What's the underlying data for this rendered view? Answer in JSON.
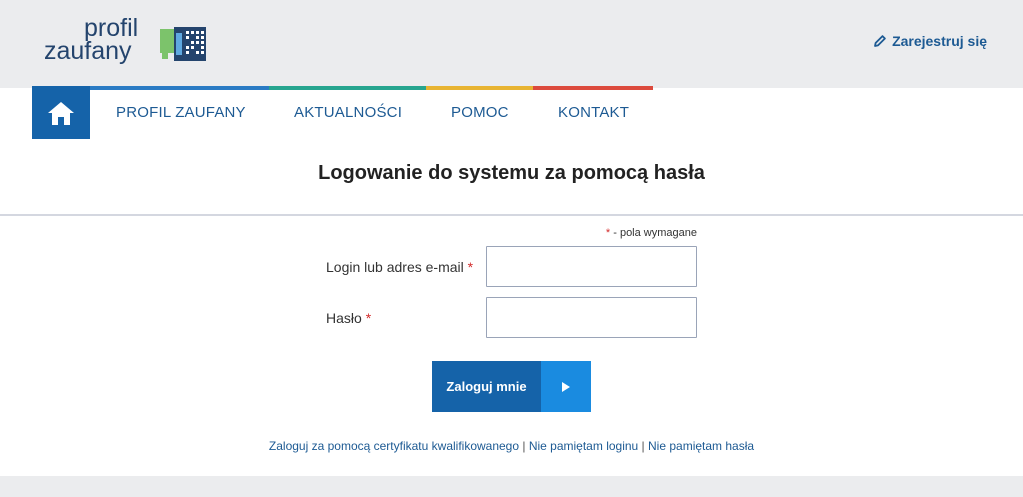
{
  "header": {
    "logo_line1": "profil",
    "logo_line2": "zaufany",
    "register_label": "Zarejestruj się"
  },
  "colors": {
    "brand_blue": "#1563a9",
    "accent_blue": "#1a8be0",
    "stripe_blue": "#2a7bc4",
    "stripe_green": "#27a58f",
    "stripe_yellow": "#e8b432",
    "stripe_red": "#dc4a3d"
  },
  "nav": {
    "items": [
      {
        "label": "PROFIL ZAUFANY"
      },
      {
        "label": "AKTUALNOŚCI"
      },
      {
        "label": "POMOC"
      },
      {
        "label": "KONTAKT"
      }
    ]
  },
  "page": {
    "title": "Logowanie do systemu za pomocą hasła"
  },
  "form": {
    "required_star": "*",
    "required_note": " - pola wymagane",
    "login_label": "Login lub adres e-mail",
    "login_value": "",
    "password_label": "Hasło",
    "password_value": "",
    "submit_label": "Zaloguj mnie"
  },
  "links": {
    "certificate": "Zaloguj za pomocą certyfikatu kwalifikowanego",
    "separator": " | ",
    "forgot_login": "Nie pamiętam loginu",
    "forgot_password": "Nie pamiętam hasła"
  }
}
